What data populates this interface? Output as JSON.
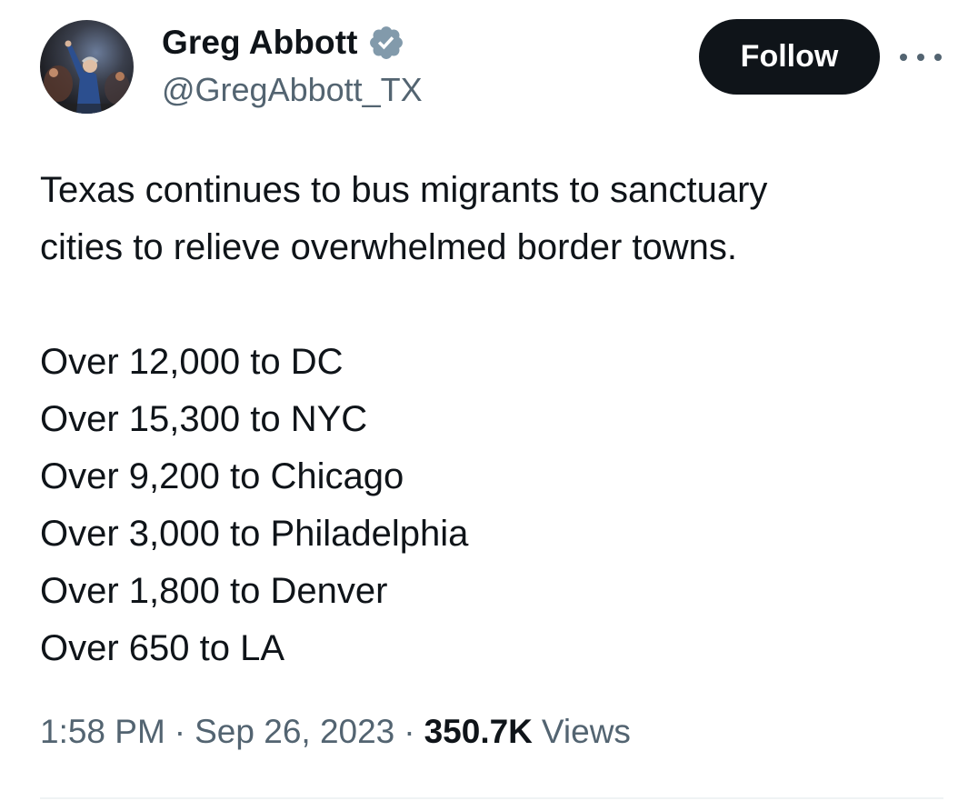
{
  "author": {
    "display_name": "Greg Abbott",
    "handle": "@GregAbbott_TX",
    "verified_badge_icon": "verified-badge-icon",
    "verified_color": "#829aab"
  },
  "actions": {
    "follow_label": "Follow",
    "more_icon": "more-options-icon"
  },
  "tweet": {
    "intro_line1": "Texas continues to bus migrants to sanctuary",
    "intro_line2": "cities to relieve overwhelmed border towns.",
    "list": [
      "Over 12,000 to DC",
      "Over 15,300 to NYC",
      "Over 9,200 to Chicago",
      "Over 3,000 to Philadelphia",
      "Over 1,800 to Denver",
      "Over 650 to LA"
    ]
  },
  "meta": {
    "time": "1:58 PM",
    "separator": "·",
    "date": "Sep 26, 2023",
    "views_count": "350.7K",
    "views_label": "Views"
  },
  "colors": {
    "text_primary": "#0f1419",
    "text_secondary": "#536471",
    "button_bg": "#0f1419",
    "button_text": "#ffffff"
  }
}
